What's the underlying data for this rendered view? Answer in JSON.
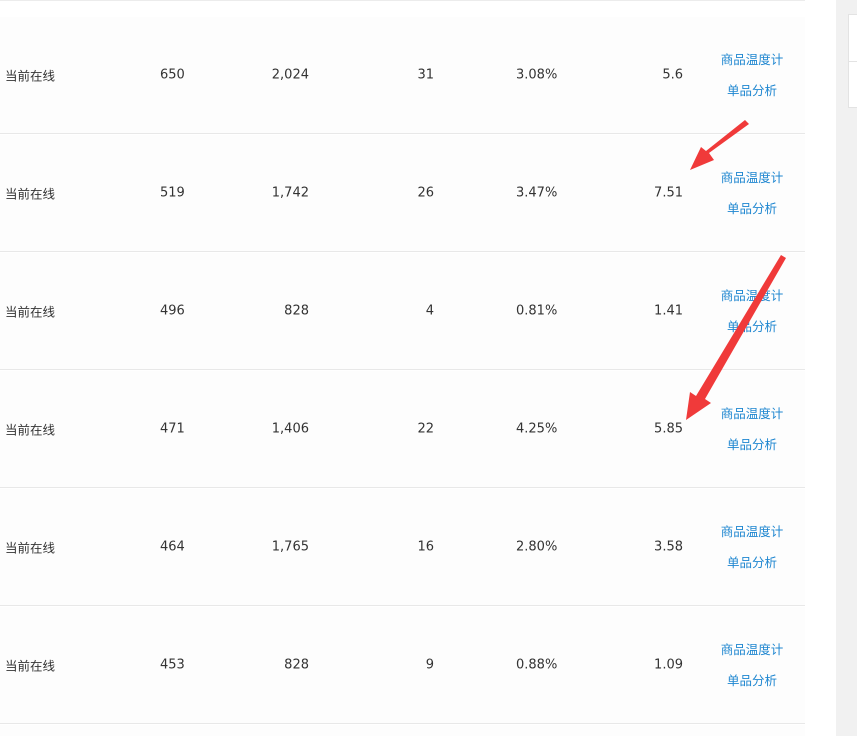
{
  "table": {
    "rows": [
      {
        "status": "当前在线",
        "col_a": "650",
        "col_b": "2,024",
        "col_c": "31",
        "col_d": "3.08%",
        "col_e": "5.6",
        "link_temperature": "商品温度计",
        "link_analysis": "单品分析"
      },
      {
        "status": "当前在线",
        "col_a": "519",
        "col_b": "1,742",
        "col_c": "26",
        "col_d": "3.47%",
        "col_e": "7.51",
        "link_temperature": "商品温度计",
        "link_analysis": "单品分析"
      },
      {
        "status": "当前在线",
        "col_a": "496",
        "col_b": "828",
        "col_c": "4",
        "col_d": "0.81%",
        "col_e": "1.41",
        "link_temperature": "商品温度计",
        "link_analysis": "单品分析"
      },
      {
        "status": "当前在线",
        "col_a": "471",
        "col_b": "1,406",
        "col_c": "22",
        "col_d": "4.25%",
        "col_e": "5.85",
        "link_temperature": "商品温度计",
        "link_analysis": "单品分析"
      },
      {
        "status": "当前在线",
        "col_a": "464",
        "col_b": "1,765",
        "col_c": "16",
        "col_d": "2.80%",
        "col_e": "3.58",
        "link_temperature": "商品温度计",
        "link_analysis": "单品分析"
      },
      {
        "status": "当前在线",
        "col_a": "453",
        "col_b": "828",
        "col_c": "9",
        "col_d": "0.88%",
        "col_e": "1.09",
        "link_temperature": "商品温度计",
        "link_analysis": "单品分析"
      }
    ]
  },
  "colors": {
    "link": "#1e86d0",
    "annotation_arrow": "#f03a3a",
    "text": "#333333",
    "row_border": "#e8e8e8"
  },
  "annotations": {
    "arrows": [
      {
        "icon": "red-arrow-icon",
        "points_to": "row 2 last value 7.51"
      },
      {
        "icon": "red-arrow-icon",
        "points_to": "row 4 last value 5.85"
      }
    ]
  }
}
